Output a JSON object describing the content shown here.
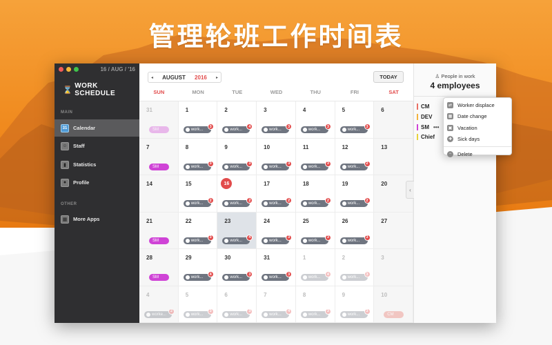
{
  "headline": "管理轮班工作时间表",
  "window": {
    "date_top": "16 / AUG / '16",
    "logo_text": "WORK SCHEDULE"
  },
  "sidebar": {
    "main_label": "MAIN",
    "other_label": "OTHER",
    "items": [
      {
        "label": "Calendar",
        "icon": "calendar-icon",
        "badge": "31"
      },
      {
        "label": "Staff",
        "icon": "staff-icon"
      },
      {
        "label": "Statistics",
        "icon": "statistics-icon"
      },
      {
        "label": "Profile",
        "icon": "profile-icon"
      }
    ],
    "other_items": [
      {
        "label": "More Apps",
        "icon": "apps-icon"
      }
    ]
  },
  "toolbar": {
    "month": "AUGUST",
    "year": "2016",
    "prev": "◂",
    "next": "▸",
    "today": "TODAY"
  },
  "weekdays": [
    "SUN",
    "MON",
    "TUE",
    "WED",
    "THU",
    "FRI",
    "SAT"
  ],
  "colors": {
    "accent": "#e24b4b",
    "sm": "#cf43d6",
    "cm": "#ea6f64",
    "work": "#6f7580"
  },
  "calendar": {
    "days": [
      {
        "n": "31",
        "dim": true,
        "chip": {
          "t": "SM",
          "k": "sm",
          "dim": true
        }
      },
      {
        "n": "1",
        "chip": {
          "t": "work...",
          "k": "work",
          "b": "3"
        }
      },
      {
        "n": "2",
        "chip": {
          "t": "work...",
          "k": "work",
          "b": "4"
        }
      },
      {
        "n": "3",
        "chip": {
          "t": "work...",
          "k": "work",
          "b": "3"
        }
      },
      {
        "n": "4",
        "chip": {
          "t": "work...",
          "k": "work",
          "b": "3"
        }
      },
      {
        "n": "5",
        "chip": {
          "t": "work...",
          "k": "work",
          "b": "3"
        }
      },
      {
        "n": "6"
      },
      {
        "n": "7",
        "chip": {
          "t": "SM",
          "k": "sm"
        }
      },
      {
        "n": "8",
        "chip": {
          "t": "work...",
          "k": "work",
          "b": "3"
        }
      },
      {
        "n": "9",
        "chip": {
          "t": "work...",
          "k": "work",
          "b": "3"
        }
      },
      {
        "n": "10",
        "chip": {
          "t": "work...",
          "k": "work",
          "b": "3"
        }
      },
      {
        "n": "11",
        "chip": {
          "t": "work...",
          "k": "work",
          "b": "3"
        }
      },
      {
        "n": "12",
        "chip": {
          "t": "work...",
          "k": "work",
          "b": "2"
        }
      },
      {
        "n": "13"
      },
      {
        "n": "14"
      },
      {
        "n": "15",
        "chip": {
          "t": "work...",
          "k": "work",
          "b": "2"
        }
      },
      {
        "n": "16",
        "today": true,
        "chip": {
          "t": "work...",
          "k": "work",
          "b": "2"
        }
      },
      {
        "n": "17",
        "chip": {
          "t": "work...",
          "k": "work",
          "b": "2"
        }
      },
      {
        "n": "18",
        "chip": {
          "t": "work...",
          "k": "work",
          "b": "2"
        }
      },
      {
        "n": "19",
        "chip": {
          "t": "work...",
          "k": "work",
          "b": "2"
        }
      },
      {
        "n": "20"
      },
      {
        "n": "21",
        "chip": {
          "t": "SM",
          "k": "sm"
        }
      },
      {
        "n": "22",
        "chip": {
          "t": "work...",
          "k": "work",
          "b": "3"
        }
      },
      {
        "n": "23",
        "selected": true,
        "chip": {
          "t": "work...",
          "k": "work",
          "b": "4"
        }
      },
      {
        "n": "24",
        "chip": {
          "t": "work...",
          "k": "work",
          "b": "3"
        }
      },
      {
        "n": "25",
        "chip": {
          "t": "work...",
          "k": "work",
          "b": "3"
        }
      },
      {
        "n": "26",
        "chip": {
          "t": "work...",
          "k": "work",
          "b": "3"
        }
      },
      {
        "n": "27"
      },
      {
        "n": "28",
        "chip": {
          "t": "SM",
          "k": "sm"
        }
      },
      {
        "n": "29",
        "chip": {
          "t": "work...",
          "k": "work",
          "b": "4"
        }
      },
      {
        "n": "30",
        "chip": {
          "t": "work...",
          "k": "work",
          "b": "3"
        }
      },
      {
        "n": "31",
        "chip": {
          "t": "work...",
          "k": "work",
          "b": "3"
        }
      },
      {
        "n": "1",
        "dim": true,
        "chip": {
          "t": "work...",
          "k": "work",
          "b": "4",
          "dim": true
        }
      },
      {
        "n": "2",
        "dim": true,
        "chip": {
          "t": "work...",
          "k": "work",
          "b": "3",
          "dim": true
        }
      },
      {
        "n": "3",
        "dim": true
      },
      {
        "n": "4",
        "dim": true,
        "chip": {
          "t": "worke...",
          "k": "work",
          "b": "2",
          "dim": true
        }
      },
      {
        "n": "5",
        "dim": true,
        "chip": {
          "t": "work...",
          "k": "work",
          "b": "3",
          "dim": true
        }
      },
      {
        "n": "6",
        "dim": true,
        "chip": {
          "t": "work...",
          "k": "work",
          "b": "3",
          "dim": true
        }
      },
      {
        "n": "7",
        "dim": true,
        "chip": {
          "t": "work...",
          "k": "work",
          "b": "4",
          "dim": true
        }
      },
      {
        "n": "8",
        "dim": true,
        "chip": {
          "t": "work...",
          "k": "work",
          "b": "3",
          "dim": true
        }
      },
      {
        "n": "9",
        "dim": true,
        "chip": {
          "t": "work...",
          "k": "work",
          "b": "3",
          "dim": true
        }
      },
      {
        "n": "10",
        "dim": true,
        "chip": {
          "t": "CM",
          "k": "cm",
          "dim": true
        }
      }
    ]
  },
  "right_panel": {
    "title": "People in work",
    "count": "4 employees",
    "more": "•••",
    "collapse": "‹",
    "roles": [
      {
        "label": "CM",
        "color": "#ea6f64"
      },
      {
        "label": "DEV",
        "color": "#f2b33d"
      },
      {
        "label": "SM",
        "color": "#cf43d6"
      },
      {
        "label": "Chief",
        "color": "#e8d23a"
      }
    ]
  },
  "context_menu": {
    "items": [
      {
        "label": "Worker displace",
        "icon": "swap-icon"
      },
      {
        "label": "Date change",
        "icon": "calendar-icon"
      },
      {
        "label": "Vacation",
        "icon": "suitcase-icon"
      },
      {
        "label": "Sick days",
        "icon": "sick-icon"
      }
    ],
    "delete": {
      "label": "Delete",
      "icon": "delete-icon"
    }
  }
}
